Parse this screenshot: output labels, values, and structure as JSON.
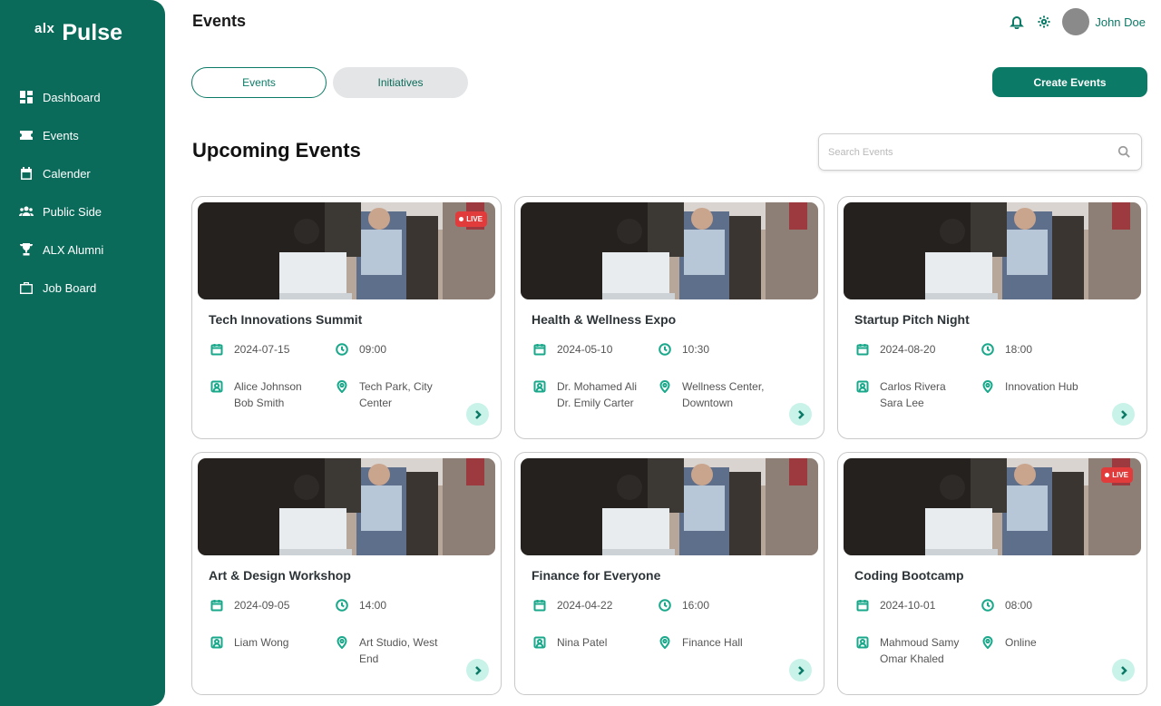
{
  "brand": {
    "prefix": "alx",
    "name": "Pulse"
  },
  "sidebar": {
    "items": [
      {
        "label": "Dashboard",
        "icon": "dashboard-icon"
      },
      {
        "label": "Events",
        "icon": "ticket-icon"
      },
      {
        "label": "Calender",
        "icon": "calendar-icon"
      },
      {
        "label": "Public Side",
        "icon": "group-icon"
      },
      {
        "label": "ALX Alumni",
        "icon": "trophy-icon"
      },
      {
        "label": "Job Board",
        "icon": "briefcase-icon"
      }
    ]
  },
  "header": {
    "title": "Events",
    "user_name": "John Doe"
  },
  "tabs": {
    "events": "Events",
    "initiatives": "Initiatives"
  },
  "actions": {
    "create": "Create Events"
  },
  "section": {
    "title": "Upcoming Events"
  },
  "search": {
    "placeholder": "Search Events",
    "value": ""
  },
  "colors": {
    "primary": "#0b6b5a",
    "accent": "#0b7a66",
    "live": "#e23b3b",
    "icon": "#1aa88b"
  },
  "events": [
    {
      "title": "Tech Innovations Summit",
      "date": "2024-07-15",
      "time": "09:00",
      "people": [
        "Alice Johnson",
        "Bob Smith"
      ],
      "location": [
        "Tech Park, City",
        "Center"
      ],
      "live": "LIVE"
    },
    {
      "title": "Health & Wellness Expo",
      "date": "2024-05-10",
      "time": "10:30",
      "people": [
        "Dr. Mohamed Ali",
        "Dr. Emily Carter"
      ],
      "location": [
        "Wellness Center,",
        "Downtown"
      ],
      "live": ""
    },
    {
      "title": "Startup Pitch Night",
      "date": "2024-08-20",
      "time": "18:00",
      "people": [
        "Carlos Rivera",
        "Sara Lee"
      ],
      "location": [
        "Innovation Hub",
        ""
      ],
      "live": ""
    },
    {
      "title": "Art & Design Workshop",
      "date": "2024-09-05",
      "time": "14:00",
      "people": [
        "Liam Wong",
        ""
      ],
      "location": [
        "Art Studio, West",
        "End"
      ],
      "live": ""
    },
    {
      "title": "Finance for Everyone",
      "date": "2024-04-22",
      "time": "16:00",
      "people": [
        "Nina Patel",
        ""
      ],
      "location": [
        "Finance Hall",
        ""
      ],
      "live": ""
    },
    {
      "title": "Coding Bootcamp",
      "date": "2024-10-01",
      "time": "08:00",
      "people": [
        "Mahmoud Samy",
        "Omar Khaled"
      ],
      "location": [
        "Online",
        ""
      ],
      "live": "LIVE"
    }
  ]
}
